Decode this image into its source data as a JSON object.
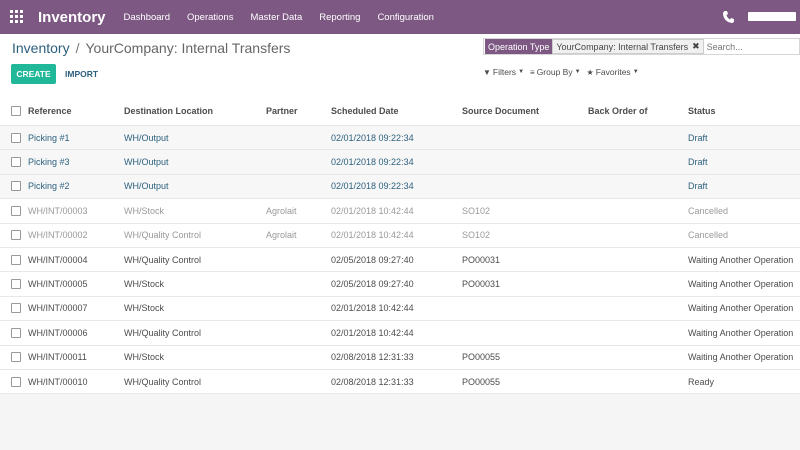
{
  "navbar": {
    "app_name": "Inventory",
    "menu": [
      "Dashboard",
      "Operations",
      "Master Data",
      "Reporting",
      "Configuration"
    ]
  },
  "breadcrumb": {
    "parent": "Inventory",
    "separator": "/",
    "current": "YourCompany: Internal Transfers"
  },
  "buttons": {
    "create": "CREATE",
    "import": "IMPORT"
  },
  "search": {
    "facet_label": "Operation Type",
    "facet_value": "YourCompany: Internal Transfers",
    "facet_close": "✖",
    "placeholder": "Search..."
  },
  "filters": {
    "filters_label": "Filters",
    "group_by_label": "Group By",
    "favorites_label": "Favorites"
  },
  "table": {
    "columns": [
      "Reference",
      "Destination Location",
      "Partner",
      "Scheduled Date",
      "Source Document",
      "Back Order of",
      "Status"
    ],
    "rows": [
      {
        "ref": "Picking #1",
        "dest": "WH/Output",
        "partner": "",
        "date": "02/01/2018 09:22:34",
        "src": "",
        "back": "",
        "status": "Draft",
        "kind": "draft"
      },
      {
        "ref": "Picking #3",
        "dest": "WH/Output",
        "partner": "",
        "date": "02/01/2018 09:22:34",
        "src": "",
        "back": "",
        "status": "Draft",
        "kind": "draft"
      },
      {
        "ref": "Picking #2",
        "dest": "WH/Output",
        "partner": "",
        "date": "02/01/2018 09:22:34",
        "src": "",
        "back": "",
        "status": "Draft",
        "kind": "draft"
      },
      {
        "ref": "WH/INT/00003",
        "dest": "WH/Stock",
        "partner": "Agrolait",
        "date": "02/01/2018 10:42:44",
        "src": "SO102",
        "back": "",
        "status": "Cancelled",
        "kind": "muted"
      },
      {
        "ref": "WH/INT/00002",
        "dest": "WH/Quality Control",
        "partner": "Agrolait",
        "date": "02/01/2018 10:42:44",
        "src": "SO102",
        "back": "",
        "status": "Cancelled",
        "kind": "muted"
      },
      {
        "ref": "WH/INT/00004",
        "dest": "WH/Quality Control",
        "partner": "",
        "date": "02/05/2018 09:27:40",
        "src": "PO00031",
        "back": "",
        "status": "Waiting Another Operation",
        "kind": "normal"
      },
      {
        "ref": "WH/INT/00005",
        "dest": "WH/Stock",
        "partner": "",
        "date": "02/05/2018 09:27:40",
        "src": "PO00031",
        "back": "",
        "status": "Waiting Another Operation",
        "kind": "normal"
      },
      {
        "ref": "WH/INT/00007",
        "dest": "WH/Stock",
        "partner": "",
        "date": "02/01/2018 10:42:44",
        "src": "",
        "back": "",
        "status": "Waiting Another Operation",
        "kind": "normal"
      },
      {
        "ref": "WH/INT/00006",
        "dest": "WH/Quality Control",
        "partner": "",
        "date": "02/01/2018 10:42:44",
        "src": "",
        "back": "",
        "status": "Waiting Another Operation",
        "kind": "normal"
      },
      {
        "ref": "WH/INT/00011",
        "dest": "WH/Stock",
        "partner": "",
        "date": "02/08/2018 12:31:33",
        "src": "PO00055",
        "back": "",
        "status": "Waiting Another Operation",
        "kind": "normal"
      },
      {
        "ref": "WH/INT/00010",
        "dest": "WH/Quality Control",
        "partner": "",
        "date": "02/08/2018 12:31:33",
        "src": "PO00055",
        "back": "",
        "status": "Ready",
        "kind": "normal"
      }
    ]
  },
  "colors": {
    "brand": "#7c5883",
    "primary_button": "#21b799",
    "link": "#2b5f7d"
  }
}
